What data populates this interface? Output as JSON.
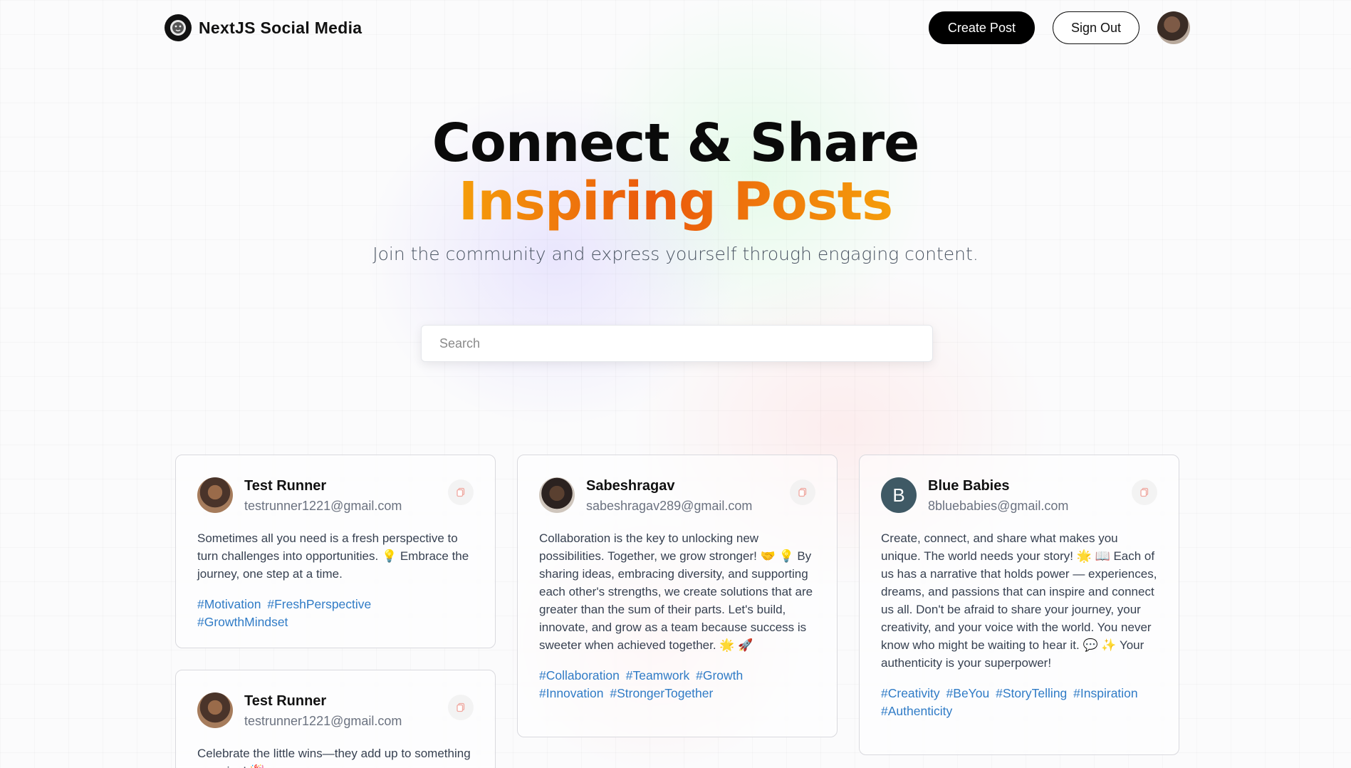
{
  "nav": {
    "brand": "NextJS Social Media",
    "create_post": "Create Post",
    "sign_out": "Sign Out"
  },
  "hero": {
    "title_line1": "Connect & Share",
    "title_line2": "Inspiring Posts",
    "subtitle": "Join the community and express yourself through engaging content."
  },
  "search": {
    "placeholder": "Search",
    "value": ""
  },
  "posts": [
    {
      "name": "Test Runner",
      "email": "testrunner1221@gmail.com",
      "text": "Sometimes all you need is a fresh perspective to turn challenges into opportunities. 💡 Embrace the journey, one step at a time.",
      "tags": [
        "#Motivation",
        "#FreshPerspective",
        "#GrowthMindset"
      ]
    },
    {
      "name": "Sabeshragav",
      "email": "sabeshragav289@gmail.com",
      "text": "Collaboration is the key to unlocking new possibilities. Together, we grow stronger! 🤝 💡 By sharing ideas, embracing diversity, and supporting each other's strengths, we create solutions that are greater than the sum of their parts. Let's build, innovate, and grow as a team because success is sweeter when achieved together. 🌟 🚀",
      "tags": [
        "#Collaboration",
        "#Teamwork",
        "#Growth",
        "#Innovation",
        "#StrongerTogether"
      ]
    },
    {
      "name": "Blue Babies",
      "initial": "B",
      "email": "8bluebabies@gmail.com",
      "text": "Create, connect, and share what makes you unique. The world needs your story! 🌟 📖 Each of us has a narrative that holds power — experiences, dreams, and passions that can inspire and connect us all. Don't be afraid to share your journey, your creativity, and your voice with the world. You never know who might be waiting to hear it. 💬 ✨ Your authenticity is your superpower!",
      "tags": [
        "#Creativity",
        "#BeYou",
        "#StoryTelling",
        "#Inspiration",
        "#Authenticity"
      ]
    },
    {
      "name": "Test Runner",
      "email": "testrunner1221@gmail.com",
      "text": "Celebrate the little wins—they add up to something amazing! 🎉",
      "tags": []
    }
  ],
  "icons": {
    "brand": "lion-logo-icon",
    "copy": "copy-icon",
    "user_avatar": "user-avatar"
  },
  "colors": {
    "accent_from": "#f59e0b",
    "accent_to": "#ea580c",
    "tag": "#2f7bc6",
    "primary_button": "#000000"
  }
}
